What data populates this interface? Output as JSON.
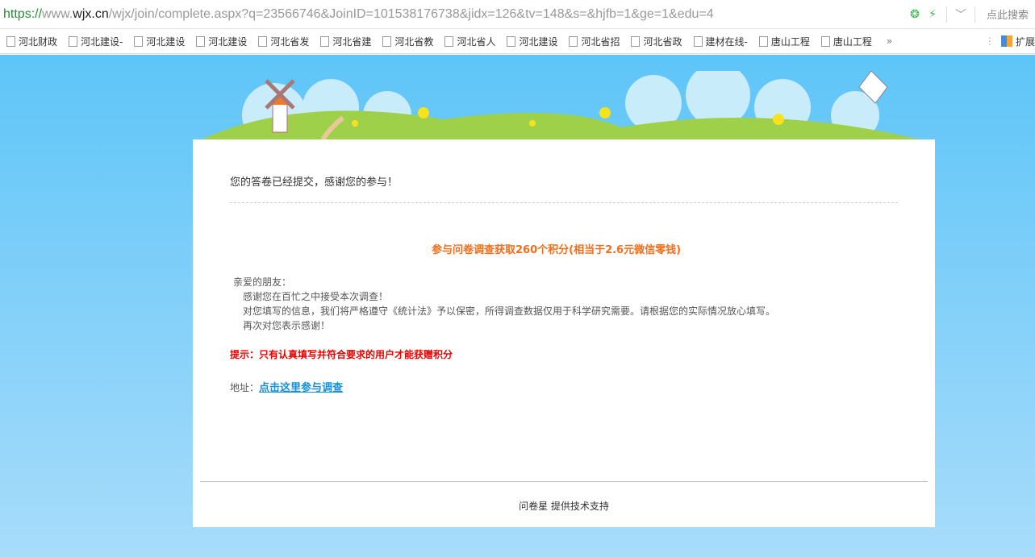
{
  "browser": {
    "url_scheme": "https://",
    "url_pre": "www.",
    "url_domain": "wjx.cn",
    "url_path": "/wjx/join/complete.aspx?q=23566746&JoinID=101538176738&jidx=126&tv=148&s=&hjfb=1&ge=1&edu=4",
    "search_label": "点此搜索",
    "bookmarks": [
      "河北财政",
      "河北建设-",
      "河北建设",
      "河北建设",
      "河北省发",
      "河北省建",
      "河北省教",
      "河北省人",
      "河北建设",
      "河北省招",
      "河北省政",
      "建材在线-",
      "唐山工程",
      "唐山工程"
    ],
    "more": "»",
    "extensions": "扩展"
  },
  "content": {
    "submitted": "您的答卷已经提交，感谢您的参与！",
    "points": "参与问卷调查获取260个积分(相当于2.6元微信零钱)",
    "greeting": "亲爱的朋友：",
    "lines": [
      "感谢您在百忙之中接受本次调查！",
      "对您填写的信息，我们将严格遵守《统计法》予以保密，所得调查数据仅用于科学研究需要。请根据您的实际情况放心填写。",
      "再次对您表示感谢！"
    ],
    "tip": "提示：只有认真填写并符合要求的用户才能获赠积分",
    "address_label": "地址：",
    "address_link": "点击这里参与调查",
    "footer": "问卷星 提供技术支持"
  }
}
